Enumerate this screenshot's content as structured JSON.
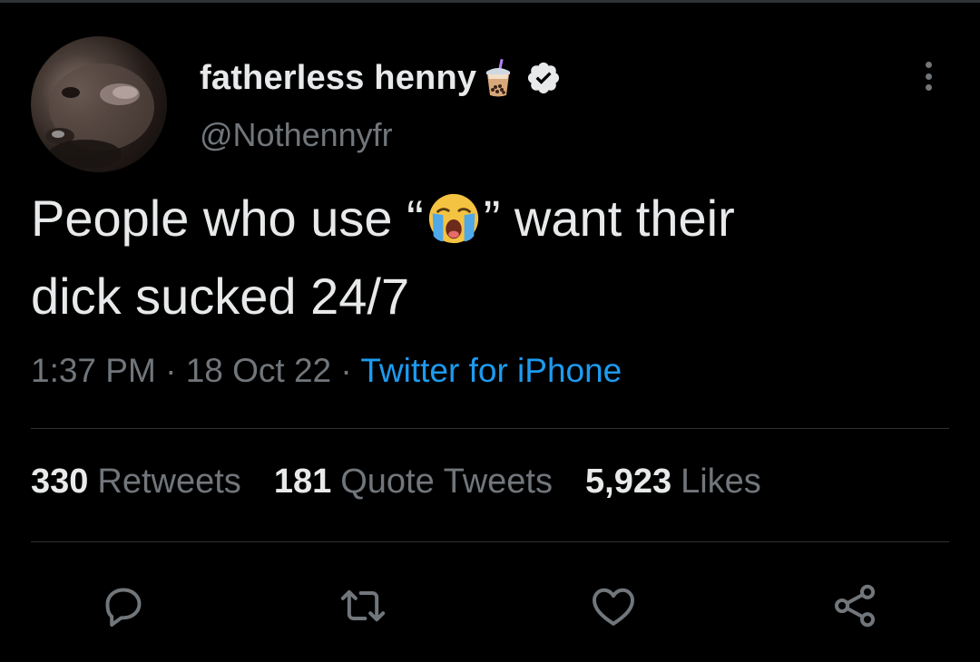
{
  "user": {
    "display_name": "fatherless henny",
    "handle": "@Nothennyfr",
    "badges": [
      "boba-tea-emoji",
      "verified-badge-icon"
    ]
  },
  "tweet": {
    "text_line1_before": "People who use “",
    "text_line1_after": "” want their",
    "text_line2": "dick sucked 24/7",
    "inline_emoji": "loudly-crying-face-emoji"
  },
  "meta": {
    "time": "1:37 PM",
    "sep1": " · ",
    "date": "18 Oct 22",
    "sep2": " · ",
    "source": "Twitter for iPhone"
  },
  "stats": {
    "retweets_count": "330",
    "retweets_label": "Retweets",
    "quotes_count": "181",
    "quotes_label": "Quote Tweets",
    "likes_count": "5,923",
    "likes_label": "Likes"
  },
  "actions": [
    "reply-icon",
    "retweet-icon",
    "like-icon",
    "share-icon"
  ],
  "colors": {
    "background": "#000000",
    "text_primary": "#e7e9ea",
    "text_secondary": "#71767b",
    "link": "#1d9bf0",
    "divider": "#2f3336"
  }
}
